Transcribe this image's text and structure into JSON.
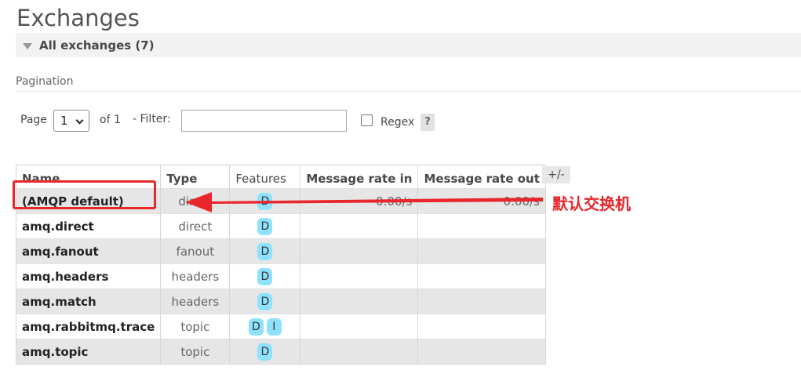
{
  "page": {
    "title": "Exchanges"
  },
  "section": {
    "title": "All exchanges (7)"
  },
  "pagination": {
    "label": "Pagination",
    "page_label": "Page",
    "page_value": "1",
    "of_label": "of 1",
    "filter_label": "- Filter:",
    "filter_value": "",
    "regex_label": "Regex",
    "regex_checked": false,
    "help_label": "?"
  },
  "table": {
    "headers": {
      "name": "Name",
      "type": "Type",
      "features": "Features",
      "rate_in": "Message rate in",
      "rate_out": "Message rate out"
    },
    "columns_toggle": "+/-",
    "rows": [
      {
        "name": "(AMQP default)",
        "type": "direct",
        "features": [
          "D"
        ],
        "rate_in": "0.00/s",
        "rate_out": "0.00/s"
      },
      {
        "name": "amq.direct",
        "type": "direct",
        "features": [
          "D"
        ],
        "rate_in": "",
        "rate_out": ""
      },
      {
        "name": "amq.fanout",
        "type": "fanout",
        "features": [
          "D"
        ],
        "rate_in": "",
        "rate_out": ""
      },
      {
        "name": "amq.headers",
        "type": "headers",
        "features": [
          "D"
        ],
        "rate_in": "",
        "rate_out": ""
      },
      {
        "name": "amq.match",
        "type": "headers",
        "features": [
          "D"
        ],
        "rate_in": "",
        "rate_out": ""
      },
      {
        "name": "amq.rabbitmq.trace",
        "type": "topic",
        "features": [
          "D",
          "I"
        ],
        "rate_in": "",
        "rate_out": ""
      },
      {
        "name": "amq.topic",
        "type": "topic",
        "features": [
          "D"
        ],
        "rate_in": "",
        "rate_out": ""
      }
    ]
  },
  "annotation": {
    "text": "默认交换机",
    "color": "#e8262c"
  },
  "colors": {
    "badge": "#8fe2ff",
    "row_alt": "#e6e6e6",
    "header_bar": "#f2f2f2"
  },
  "icons": {
    "collapse": "triangle-down-icon",
    "page_select": "chevron-down-icon",
    "arrow": "arrow-left-icon"
  }
}
